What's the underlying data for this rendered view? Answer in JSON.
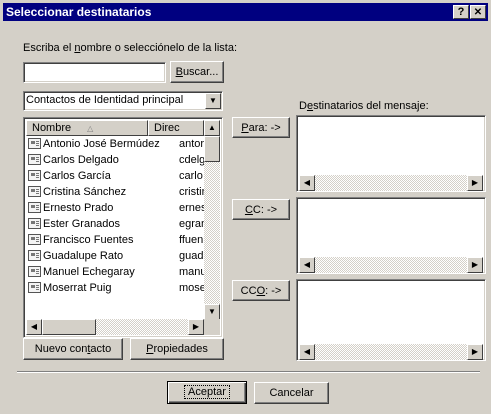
{
  "window": {
    "title": "Seleccionar destinatarios",
    "help_btn": "?",
    "close_btn": "✕"
  },
  "search": {
    "label_pre": "Escriba el ",
    "label_u": "n",
    "label_post": "ombre o selecciónelo de la lista:",
    "value": "",
    "button_u": "B",
    "button_rest": "uscar..."
  },
  "address_book": {
    "selected": "Contactos de Identidad principal"
  },
  "list": {
    "col_name": "Nombre",
    "col_email": "Direc",
    "rows": [
      {
        "name": "Antonio José Bermúdez",
        "email": "antor"
      },
      {
        "name": "Carlos Delgado",
        "email": "cdelg"
      },
      {
        "name": "Carlos García",
        "email": "carlo"
      },
      {
        "name": "Cristina Sánchez",
        "email": "cristir"
      },
      {
        "name": "Ernesto Prado",
        "email": "ernes"
      },
      {
        "name": "Ester Granados",
        "email": "egran"
      },
      {
        "name": "Francisco Fuentes",
        "email": "ffuen"
      },
      {
        "name": "Guadalupe Rato",
        "email": "guad"
      },
      {
        "name": "Manuel Echegaray",
        "email": "manu"
      },
      {
        "name": "Moserrat Puig",
        "email": "mose"
      }
    ]
  },
  "recipients": {
    "label_pre": "D",
    "label_u": "e",
    "label_post": "stinatarios del mensaje:",
    "to_u": "P",
    "to_rest": "ara: ->",
    "cc_u": "C",
    "cc_rest": "C: ->",
    "bcc_pre": "CC",
    "bcc_u": "O",
    "bcc_post": ": ->"
  },
  "buttons": {
    "new_pre": "Nuevo con",
    "new_u": "t",
    "new_post": "acto",
    "props_u": "P",
    "props_rest": "ropiedades",
    "ok": "Aceptar",
    "cancel": "Cancelar"
  },
  "colors": {
    "titlebar": "#000080",
    "face": "#d4d0c8"
  }
}
